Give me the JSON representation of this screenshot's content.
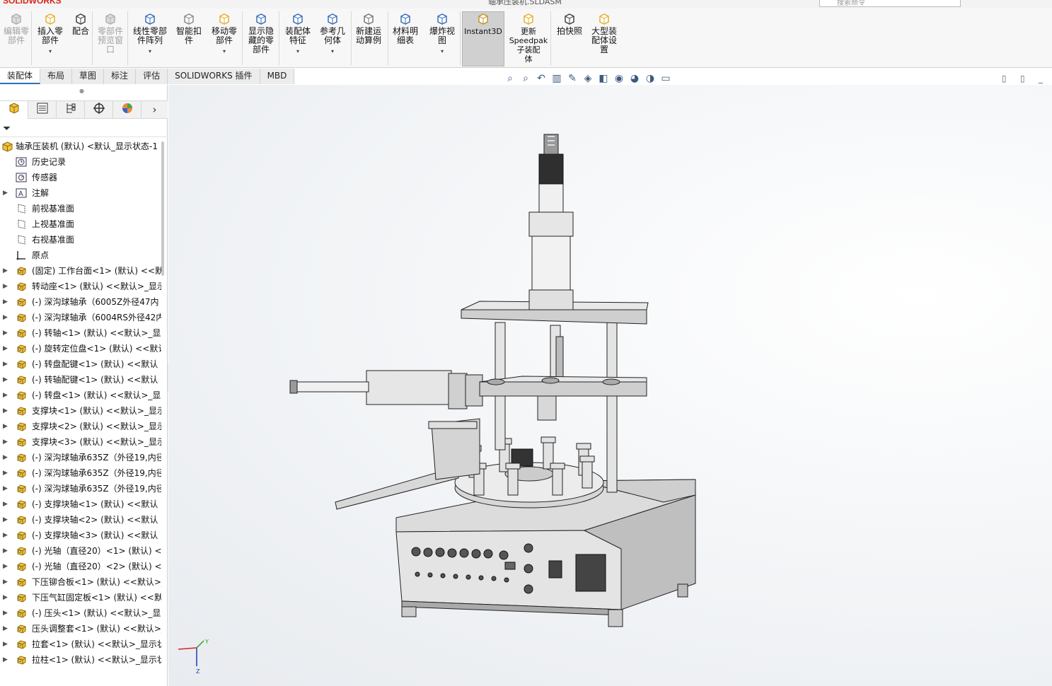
{
  "app": {
    "logo": "SOLIDWORKS",
    "doc_title": "轴承压装机.SLDASM",
    "search_placeholder": "搜索命令"
  },
  "ribbon": {
    "buttons": [
      {
        "id": "edit-component",
        "label": "编辑零\n部件",
        "disabled": true
      },
      {
        "id": "insert-components",
        "label": "插入零\n部件",
        "disabled": false
      },
      {
        "id": "mate",
        "label": "配合",
        "disabled": false
      },
      {
        "id": "component-preview",
        "label": "零部件\n预览窗\n口",
        "disabled": true
      },
      {
        "id": "linear-pattern",
        "label": "线性零部\n件阵列",
        "disabled": false
      },
      {
        "id": "smart-fasteners",
        "label": "智能扣\n件",
        "disabled": false
      },
      {
        "id": "move-component",
        "label": "移动零\n部件",
        "disabled": false
      },
      {
        "id": "show-hidden",
        "label": "显示隐\n藏的零\n部件",
        "disabled": false
      },
      {
        "id": "assembly-features",
        "label": "装配体\n特征",
        "disabled": false
      },
      {
        "id": "reference-geometry",
        "label": "参考几\n何体",
        "disabled": false
      },
      {
        "id": "new-motion-study",
        "label": "新建运\n动算例",
        "disabled": false
      },
      {
        "id": "bom",
        "label": "材料明\n细表",
        "disabled": false
      },
      {
        "id": "exploded-view",
        "label": "爆炸视\n图",
        "disabled": false
      },
      {
        "id": "instant3d",
        "label": "Instant3D",
        "disabled": false
      },
      {
        "id": "update-speedpak",
        "label": "更新\nSpeedpak\n子装配\n体",
        "disabled": false
      },
      {
        "id": "snapshot",
        "label": "拍快照",
        "disabled": false
      },
      {
        "id": "large-assembly",
        "label": "大型装\n配体设\n置",
        "disabled": false
      }
    ]
  },
  "tabs": [
    "装配体",
    "布局",
    "草图",
    "标注",
    "评估",
    "SOLIDWORKS 插件",
    "MBD"
  ],
  "tree": {
    "root": "轴承压装机 (默认) <默认_显示状态-1",
    "items": [
      {
        "label": "历史记录",
        "icon": "history-icon",
        "expand": false
      },
      {
        "label": "传感器",
        "icon": "sensor-icon",
        "expand": false
      },
      {
        "label": "注解",
        "icon": "annotation-icon",
        "expand": true
      },
      {
        "label": "前视基准面",
        "icon": "plane-icon",
        "expand": false
      },
      {
        "label": "上视基准面",
        "icon": "plane-icon",
        "expand": false
      },
      {
        "label": "右视基准面",
        "icon": "plane-icon",
        "expand": false
      },
      {
        "label": "原点",
        "icon": "origin-icon",
        "expand": false
      },
      {
        "label": "(固定) 工作台面<1> (默认) <<默",
        "icon": "part-icon",
        "expand": true
      },
      {
        "label": "转动座<1> (默认) <<默认>_显示",
        "icon": "part-icon",
        "expand": true
      },
      {
        "label": "(-) 深沟球轴承（6005Z外径47内",
        "icon": "part-icon",
        "expand": true
      },
      {
        "label": "(-) 深沟球轴承（6004RS外径42内",
        "icon": "part-icon",
        "expand": true
      },
      {
        "label": "(-) 转轴<1> (默认) <<默认>_显",
        "icon": "part-icon",
        "expand": true
      },
      {
        "label": "(-) 旋转定位盘<1> (默认) <<默认",
        "icon": "part-icon",
        "expand": true
      },
      {
        "label": "(-) 转盘配键<1> (默认) <<默认",
        "icon": "part-icon",
        "expand": true
      },
      {
        "label": "(-) 转轴配键<1> (默认) <<默认",
        "icon": "part-icon",
        "expand": true
      },
      {
        "label": "(-) 转盘<1> (默认) <<默认>_显",
        "icon": "part-icon",
        "expand": true
      },
      {
        "label": "支撑块<1> (默认) <<默认>_显示",
        "icon": "part-icon",
        "expand": true
      },
      {
        "label": "支撑块<2> (默认) <<默认>_显示",
        "icon": "part-icon",
        "expand": true
      },
      {
        "label": "支撑块<3> (默认) <<默认>_显示",
        "icon": "part-icon",
        "expand": true
      },
      {
        "label": "(-) 深沟球轴承635Z（外径19,内径",
        "icon": "part-icon",
        "expand": true
      },
      {
        "label": "(-) 深沟球轴承635Z（外径19,内径",
        "icon": "part-icon",
        "expand": true
      },
      {
        "label": "(-) 深沟球轴承635Z（外径19,内径",
        "icon": "part-icon",
        "expand": true
      },
      {
        "label": "(-) 支撑块轴<1> (默认) <<默认",
        "icon": "part-icon",
        "expand": true
      },
      {
        "label": "(-) 支撑块轴<2> (默认) <<默认",
        "icon": "part-icon",
        "expand": true
      },
      {
        "label": "(-) 支撑块轴<3> (默认) <<默认",
        "icon": "part-icon",
        "expand": true
      },
      {
        "label": "(-) 光轴（直径20）<1> (默认) <",
        "icon": "part-icon",
        "expand": true
      },
      {
        "label": "(-) 光轴（直径20）<2> (默认) <",
        "icon": "part-icon",
        "expand": true
      },
      {
        "label": "下压铆合板<1> (默认) <<默认>_",
        "icon": "part-icon",
        "expand": true
      },
      {
        "label": "下压气缸固定板<1> (默认) <<默",
        "icon": "part-icon",
        "expand": true
      },
      {
        "label": "(-) 压头<1> (默认) <<默认>_显",
        "icon": "part-icon",
        "expand": true
      },
      {
        "label": "压头调整套<1> (默认) <<默认>_",
        "icon": "part-icon",
        "expand": true
      },
      {
        "label": "拉套<1> (默认) <<默认>_显示状",
        "icon": "part-icon",
        "expand": true
      },
      {
        "label": "拉柱<1> (默认) <<默认>_显示状",
        "icon": "part-icon",
        "expand": true
      }
    ]
  }
}
